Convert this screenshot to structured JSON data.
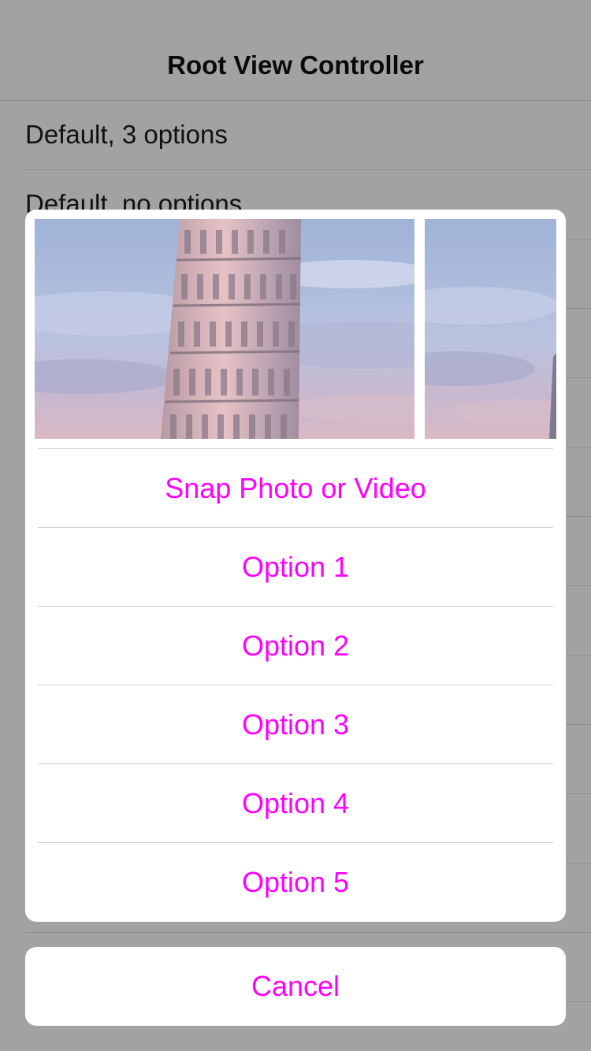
{
  "navbar": {
    "title": "Root View Controller"
  },
  "table": {
    "rows": [
      {
        "label": "Default, 3 options"
      },
      {
        "label": "Default, no options"
      }
    ]
  },
  "action_sheet": {
    "photos": [
      {
        "subject": "leaning tower of pisa photo"
      },
      {
        "subject": "leaning tower of pisa photo"
      }
    ],
    "options": [
      "Snap Photo or Video",
      "Option 1",
      "Option 2",
      "Option 3",
      "Option 4",
      "Option 5"
    ],
    "cancel_label": "Cancel"
  },
  "colors": {
    "accent": "#ff00ff",
    "dim_background": "#a2a2a2",
    "sheet_background": "#ffffff",
    "separator": "#cfcfcf"
  }
}
